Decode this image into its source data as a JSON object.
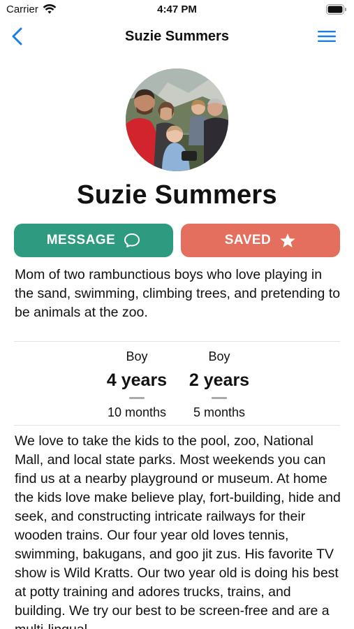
{
  "status_bar": {
    "carrier": "Carrier",
    "time": "4:47 PM",
    "icons": [
      "wifi-icon",
      "battery-icon"
    ]
  },
  "nav": {
    "title": "Suzie Summers",
    "back_icon": "chevron-left-icon",
    "menu_icon": "hamburger-menu-icon",
    "accent_color": "#1a7fe0"
  },
  "profile": {
    "name": "Suzie Summers",
    "photo": "family-photo"
  },
  "actions": {
    "message_label": "MESSAGE",
    "message_icon": "chat-bubble-icon",
    "message_color": "#2e9b80",
    "saved_label": "SAVED",
    "saved_icon": "star-icon",
    "saved_color": "#e56f5f"
  },
  "bio": "Mom of two rambunctious boys who love playing in the sand, swimming, climbing trees, and pretending to be animals at the zoo.",
  "kids": [
    {
      "gender": "Boy",
      "years": "4 years",
      "months": "10 months"
    },
    {
      "gender": "Boy",
      "years": "2 years",
      "months": "5 months"
    }
  ],
  "about": "We love to take the kids to the pool, zoo, National Mall, and local state parks. Most weekends you can find us at a nearby playground or museum. At home the kids love make believe play, fort-building, hide and seek, and constructing intricate railways for their wooden trains. Our four year old loves tennis, swimming, bakugans, and goo jit zus. His favorite TV show is Wild Kratts. Our two year old is doing his best at potty training and adores trucks, trains, and building. We try our best to be screen-free and are a multi-lingual"
}
